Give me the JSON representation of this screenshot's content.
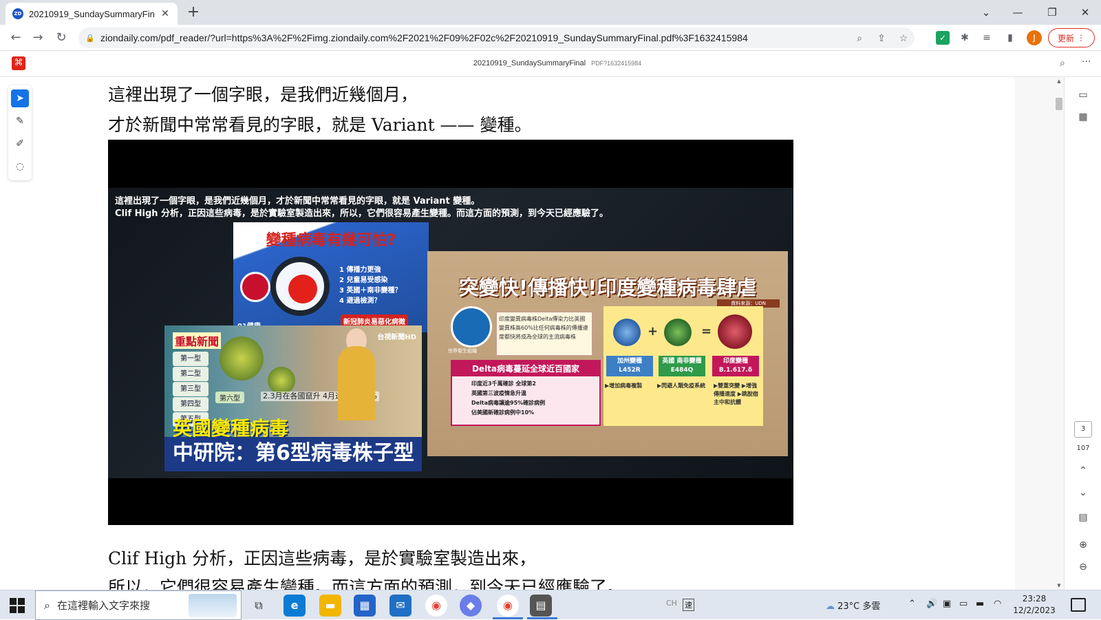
{
  "browser": {
    "tab_title": "20210919_SundaySummaryFin",
    "tab_favicon_text": "ZD",
    "url": "ziondaily.com/pdf_reader/?url=https%3A%2F%2Fimg.ziondaily.com%2F2021%2F09%2F02c%2F20210919_SundaySummaryFinal.pdf%3F1632415984",
    "avatar_letter": "J",
    "update_label": "更新",
    "accent_color": "#1a73e8",
    "update_color": "#d93025"
  },
  "pdf": {
    "file_name": "20210919_SundaySummaryFinal",
    "file_sub": "PDF?1632415984",
    "current_page": "3",
    "total_pages": "107",
    "paragraphs": [
      "這裡出現了一個字眼，是我們近幾個月，",
      "才於新聞中常常看見的字眼，就是 Variant —— 變種。",
      "Clif High 分析，正因這些病毒，是於實驗室製造出來，",
      "所以，它們很容易產生變種。而這方面的預測，到今天已經應驗了。"
    ]
  },
  "figure": {
    "caption_line1": "這裡出現了一個字眼，是我們近幾個月，才於新聞中常常看見的字眼，就是 Variant 變種。",
    "caption_line2": "Clif High 分析，正因這些病毒，是於實驗室製造出來，所以，它們很容易產生變種。而這方面的預測，到今天已經應驗了。",
    "card1": {
      "title": "變種病毒有幾可怕?",
      "items": [
        "1 傳播力更強",
        "2 兒童易受感染",
        "3 英國＋南非變種？",
        "4 避過檢測？"
      ],
      "tag": "新冠肺炎易惡化病徵",
      "logo": "01健康"
    },
    "card2": {
      "title": "突變快!傳播快!印度變種病毒肆虐",
      "source": "資料來源：UDN",
      "who_label": "世界衛生組織",
      "note": "印度變異病毒株Delta傳染力比英國變異株高60%比任何病毒株的傳播速度都快將成為全球的主流病毒株",
      "panel_title": "Delta病毒蔓延全球近百國家",
      "panel_lines": [
        "印度近3千萬確診 全球第2",
        "英國第三波疫情急升溫",
        "Delta病毒讓逾95%確診病例",
        "佔美國新確診病例中10%"
      ],
      "plus": "+",
      "equals": "=",
      "variants": [
        {
          "name": "加州變種",
          "code": "L452R",
          "note": "▶增加病毒複製"
        },
        {
          "name": "英國 南非變種",
          "code": "E484Q",
          "note": "▶閃避人類免疫系統"
        },
        {
          "name": "印度變種",
          "code": "B.1.617.δ",
          "note": "▶雙重突變 ▶增強傳播速度 ▶跳脫宿主中和抗體"
        }
      ]
    },
    "card3": {
      "key_news": "重點新聞",
      "types": [
        "第一型",
        "第二型",
        "第三型",
        "第四型",
        "第五型"
      ],
      "sixth": "第六型",
      "pct": "2.3月在各國竄升 4月迄今 型99%",
      "hd_logo": "台視新聞HD",
      "headline1": "英國變種病毒",
      "headline2": "中研院：第6型病毒株子型"
    }
  },
  "taskbar": {
    "search_placeholder": "在這裡輸入文字來搜",
    "weather_temp": "23°C",
    "weather_desc": "多雲",
    "ime": "CH",
    "ime2": "速",
    "time": "23:28",
    "date": "12/2/2023"
  }
}
